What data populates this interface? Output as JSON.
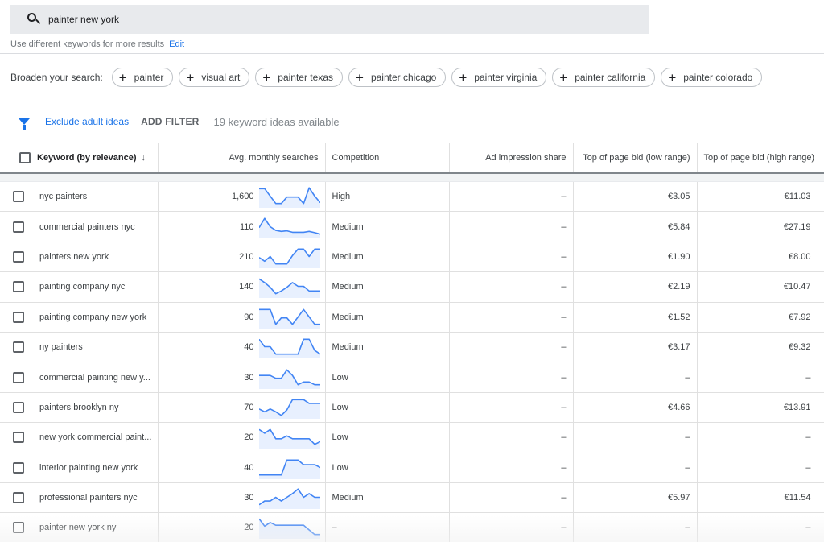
{
  "search": {
    "query": "painter new york",
    "icon": "search-icon",
    "hint": "Use different keywords for more results",
    "edit_label": "Edit"
  },
  "broaden": {
    "label": "Broaden your search:",
    "chips": [
      "painter",
      "visual art",
      "painter texas",
      "painter chicago",
      "painter virginia",
      "painter california",
      "painter colorado"
    ]
  },
  "filters": {
    "icon": "filter-icon",
    "exclude_label": "Exclude adult ideas",
    "add_filter_label": "ADD FILTER",
    "ideas_count": "19 keyword ideas available"
  },
  "colors": {
    "accent": "#1a73e8",
    "sparkline_line": "#4285f4",
    "sparkline_fill": "#e8f0fe"
  },
  "table": {
    "headers": {
      "keyword": "Keyword (by relevance)",
      "sort_icon": "↓",
      "searches": "Avg. monthly searches",
      "competition": "Competition",
      "impression_share": "Ad impression share",
      "bid_low": "Top of page bid (low range)",
      "bid_high": "Top of page bid (high range)"
    },
    "rows": [
      {
        "keyword": "nyc painters",
        "searches": "1,600",
        "trend": [
          0.9,
          0.9,
          0.5,
          0.1,
          0.1,
          0.45,
          0.45,
          0.45,
          0.1,
          0.95,
          0.5,
          0.15
        ],
        "competition": "High",
        "impression_share": "–",
        "bid_low": "€3.05",
        "bid_high": "€11.03"
      },
      {
        "keyword": "commercial painters nyc",
        "searches": "110",
        "trend": [
          0.45,
          0.95,
          0.5,
          0.3,
          0.25,
          0.28,
          0.2,
          0.2,
          0.2,
          0.25,
          0.18,
          0.1
        ],
        "competition": "Medium",
        "impression_share": "–",
        "bid_low": "€5.84",
        "bid_high": "€27.19"
      },
      {
        "keyword": "painters new york",
        "searches": "210",
        "trend": [
          0.45,
          0.25,
          0.5,
          0.1,
          0.1,
          0.1,
          0.55,
          0.9,
          0.9,
          0.5,
          0.9,
          0.9
        ],
        "competition": "Medium",
        "impression_share": "–",
        "bid_low": "€1.90",
        "bid_high": "€8.00"
      },
      {
        "keyword": "painting company nyc",
        "searches": "140",
        "trend": [
          0.9,
          0.7,
          0.45,
          0.1,
          0.25,
          0.45,
          0.7,
          0.5,
          0.5,
          0.25,
          0.25,
          0.25
        ],
        "competition": "Medium",
        "impression_share": "–",
        "bid_low": "€2.19",
        "bid_high": "€10.47"
      },
      {
        "keyword": "painting company new york",
        "searches": "90",
        "trend": [
          0.9,
          0.9,
          0.9,
          0.1,
          0.45,
          0.45,
          0.1,
          0.5,
          0.9,
          0.5,
          0.1,
          0.1
        ],
        "competition": "Medium",
        "impression_share": "–",
        "bid_low": "€1.52",
        "bid_high": "€7.92"
      },
      {
        "keyword": "ny painters",
        "searches": "40",
        "trend": [
          0.9,
          0.5,
          0.5,
          0.1,
          0.1,
          0.1,
          0.1,
          0.1,
          0.9,
          0.9,
          0.3,
          0.1
        ],
        "competition": "Medium",
        "impression_share": "–",
        "bid_low": "€3.17",
        "bid_high": "€9.32"
      },
      {
        "keyword": "commercial painting new y...",
        "searches": "30",
        "trend": [
          0.6,
          0.6,
          0.6,
          0.45,
          0.45,
          0.9,
          0.6,
          0.1,
          0.25,
          0.25,
          0.1,
          0.1
        ],
        "competition": "Low",
        "impression_share": "–",
        "bid_low": "–",
        "bid_high": "–"
      },
      {
        "keyword": "painters brooklyn ny",
        "searches": "70",
        "trend": [
          0.4,
          0.25,
          0.4,
          0.25,
          0.05,
          0.35,
          0.9,
          0.9,
          0.9,
          0.7,
          0.7,
          0.7
        ],
        "competition": "Low",
        "impression_share": "–",
        "bid_low": "€4.66",
        "bid_high": "€13.91"
      },
      {
        "keyword": "new york commercial paint...",
        "searches": "20",
        "trend": [
          0.9,
          0.7,
          0.9,
          0.4,
          0.4,
          0.55,
          0.4,
          0.4,
          0.4,
          0.4,
          0.1,
          0.25
        ],
        "competition": "Low",
        "impression_share": "–",
        "bid_low": "–",
        "bid_high": "–"
      },
      {
        "keyword": "interior painting new york",
        "searches": "40",
        "trend": [
          0.1,
          0.1,
          0.1,
          0.1,
          0.1,
          0.9,
          0.9,
          0.9,
          0.65,
          0.65,
          0.65,
          0.5
        ],
        "competition": "Low",
        "impression_share": "–",
        "bid_low": "–",
        "bid_high": "–"
      },
      {
        "keyword": "professional painters nyc",
        "searches": "30",
        "trend": [
          0.1,
          0.3,
          0.3,
          0.5,
          0.3,
          0.5,
          0.7,
          0.95,
          0.5,
          0.7,
          0.5,
          0.5
        ],
        "competition": "Medium",
        "impression_share": "–",
        "bid_low": "€5.97",
        "bid_high": "€11.54"
      },
      {
        "keyword": "painter new york ny",
        "searches": "20",
        "trend": [
          0.95,
          0.55,
          0.75,
          0.6,
          0.6,
          0.6,
          0.6,
          0.6,
          0.6,
          0.35,
          0.1,
          0.1
        ],
        "competition": "–",
        "impression_share": "–",
        "bid_low": "–",
        "bid_high": "–"
      }
    ]
  }
}
